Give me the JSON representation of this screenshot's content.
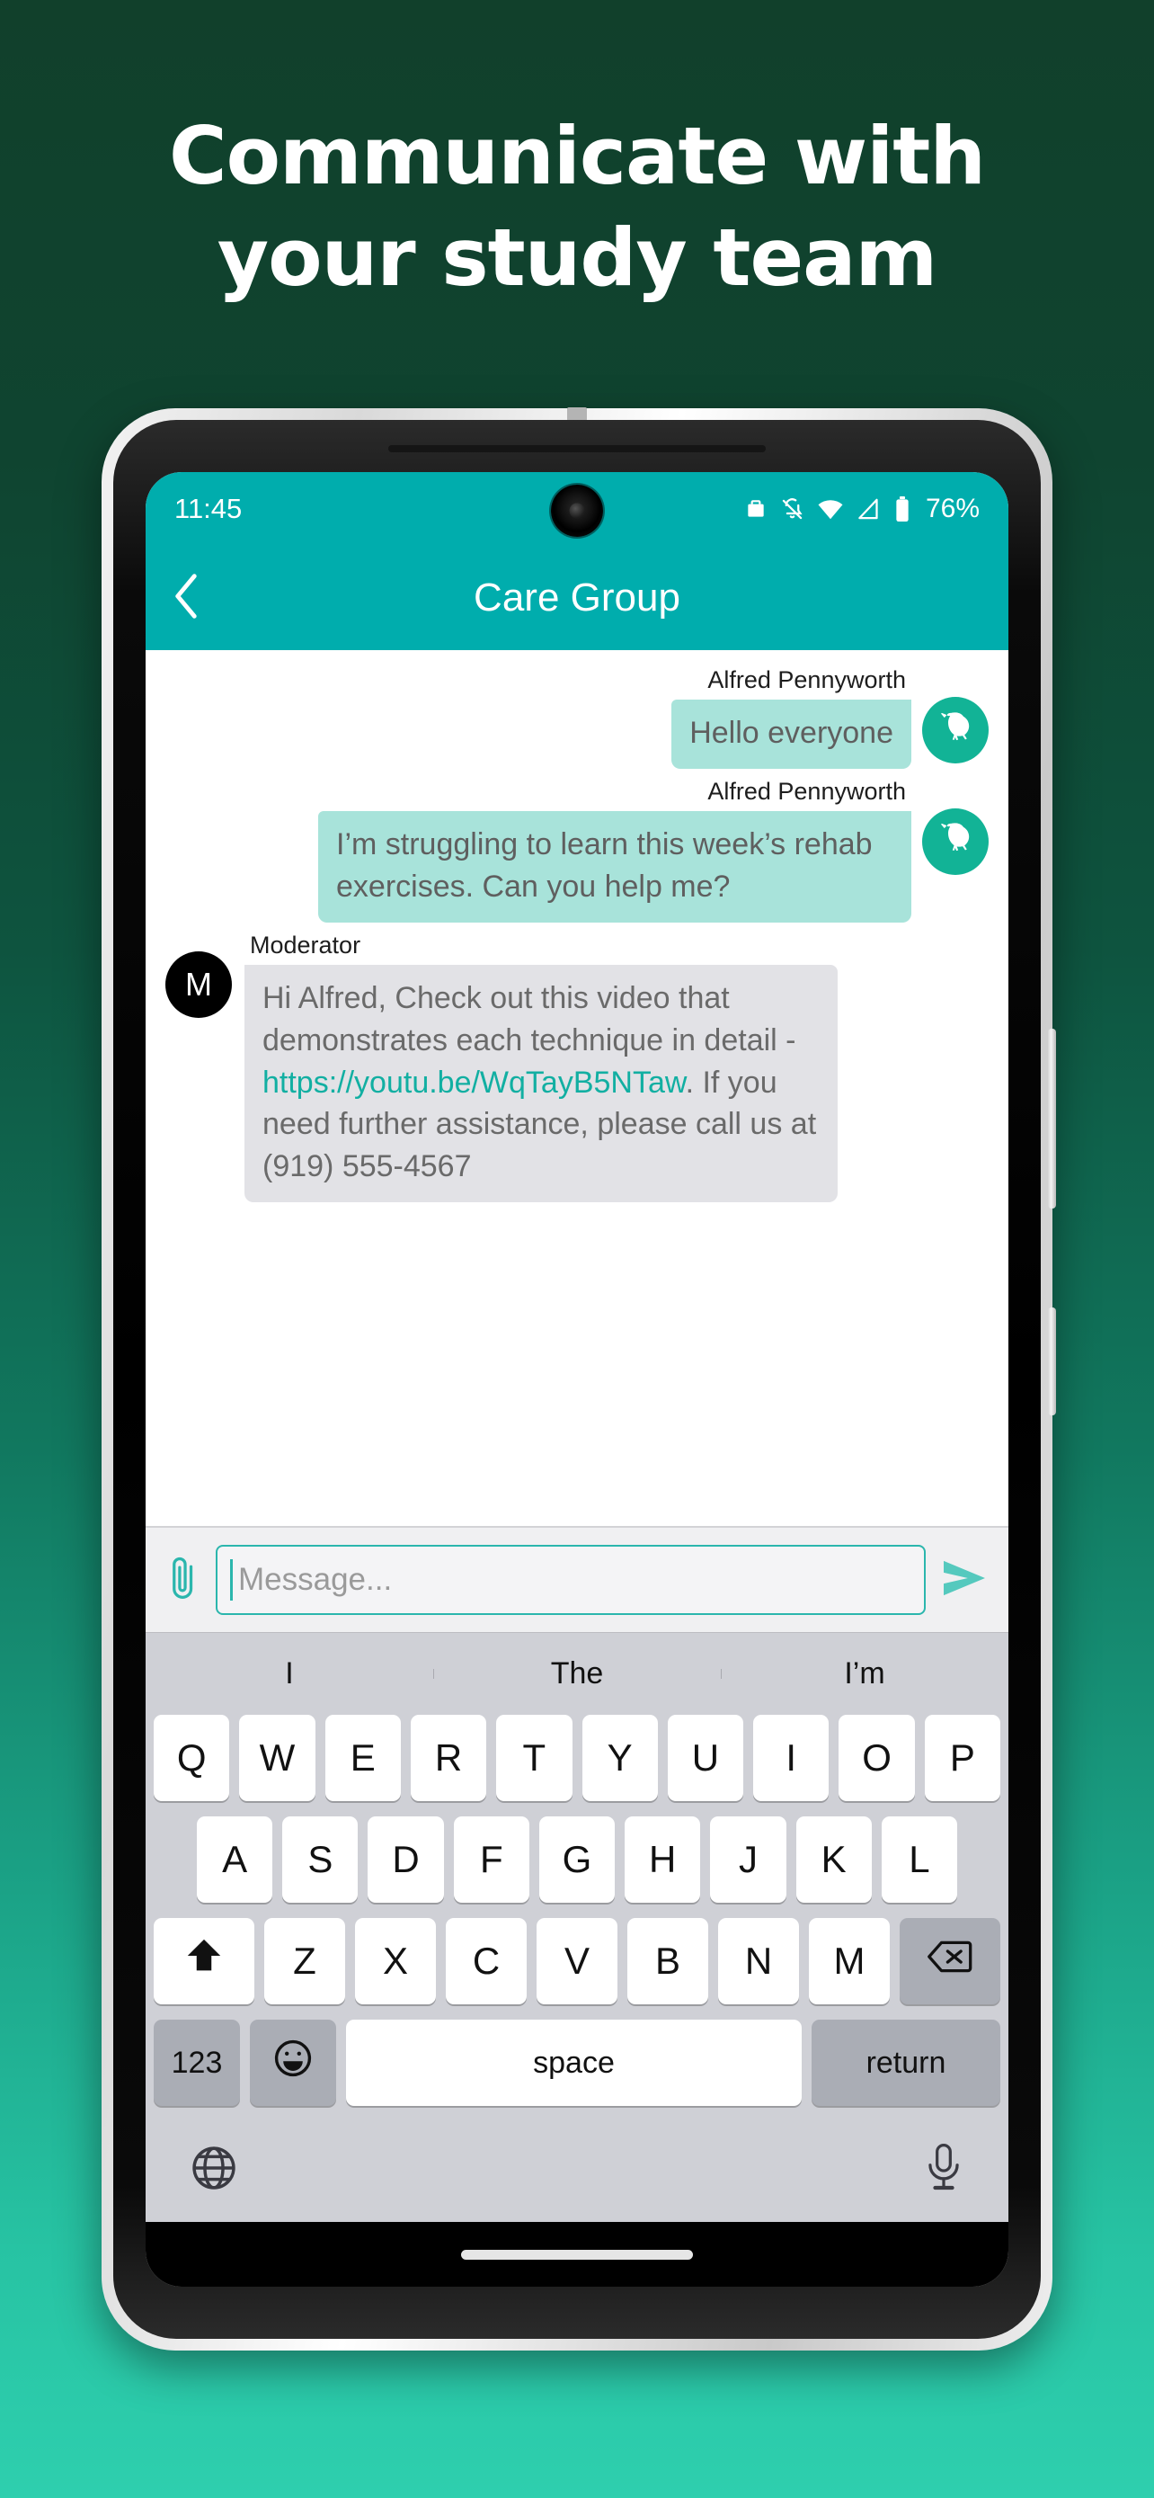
{
  "hero": {
    "line1": "Communicate with",
    "line2": "your study team"
  },
  "colors": {
    "bg_top": "#11402b",
    "bg_bottom": "#2ecfae",
    "accent_teal": "#00ADAD",
    "bubble_out": "#A8E3DA",
    "bubble_in": "#E2E2E6",
    "link": "#12AFA2",
    "avatar_teal": "#12B396",
    "keyboard_bg": "#CFD0D6"
  },
  "statusbar": {
    "time": "11:45",
    "battery_percent": "76%",
    "icons": [
      "briefcase-icon",
      "bell-off-icon",
      "wifi-icon",
      "signal-icon",
      "battery-icon"
    ]
  },
  "appbar": {
    "back_icon": "chevron-left-icon",
    "title": "Care Group"
  },
  "chat": {
    "messages": [
      {
        "sender": "Alfred Pennyworth",
        "side": "out",
        "avatar": "bird-avatar",
        "text": "Hello everyone"
      },
      {
        "sender": "Alfred Pennyworth",
        "side": "out",
        "avatar": "bird-avatar",
        "text": "I’m struggling to learn this week’s rehab exercises. Can you help me?"
      },
      {
        "sender": "Moderator",
        "side": "in",
        "avatar_initial": "M",
        "text_before": "Hi Alfred,  Check out this video that demonstrates each technique in detail - ",
        "link": "https://youtu.be/WqTayB5NTaw",
        "text_after": ".  If you need further assistance, please call us at (919) 555-4567"
      }
    ]
  },
  "input": {
    "attach_icon": "paperclip-icon",
    "placeholder": "Message...",
    "value": "",
    "send_icon": "send-arrow-icon"
  },
  "keyboard": {
    "suggestions": [
      "I",
      "The",
      "I’m"
    ],
    "row1": [
      "Q",
      "W",
      "E",
      "R",
      "T",
      "Y",
      "U",
      "I",
      "O",
      "P"
    ],
    "row2": [
      "A",
      "S",
      "D",
      "F",
      "G",
      "H",
      "J",
      "K",
      "L"
    ],
    "row3": [
      "Z",
      "X",
      "C",
      "V",
      "B",
      "N",
      "M"
    ],
    "shift_icon": "shift-arrow-icon",
    "backspace_icon": "backspace-icon",
    "num_label": "123",
    "emoji_icon": "emoji-smiley-icon",
    "space_label": "space",
    "return_label": "return",
    "globe_icon": "globe-icon",
    "mic_icon": "microphone-icon"
  }
}
